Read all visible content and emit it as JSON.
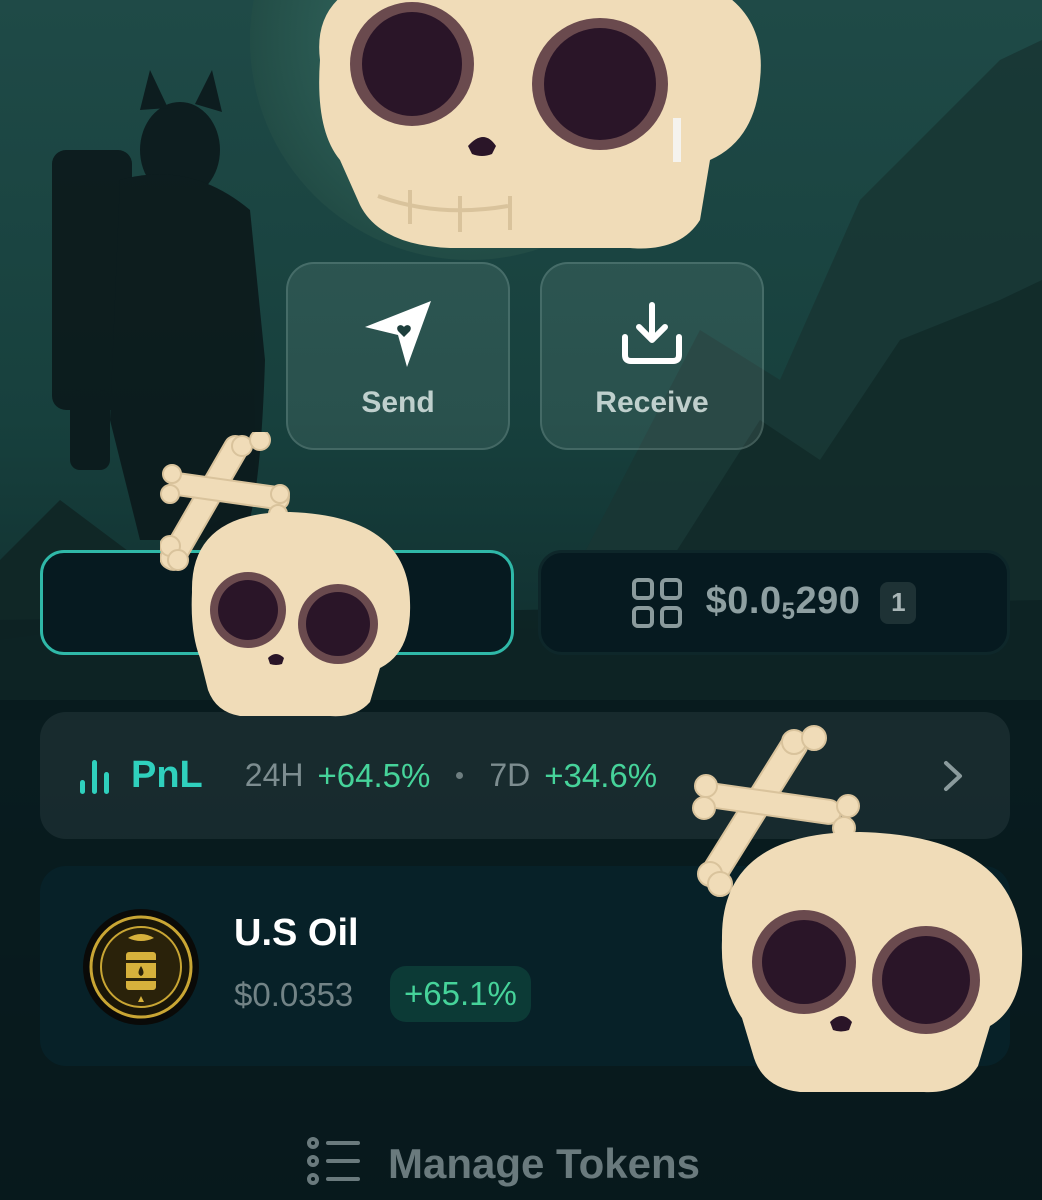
{
  "actions": {
    "send_label": "Send",
    "receive_label": "Receive"
  },
  "tabs": {
    "collectibles_value": "$0.0",
    "collectibles_value_sub": "5",
    "collectibles_value_rest": "290",
    "collectibles_count": "1"
  },
  "pnl": {
    "title": "PnL",
    "period_24h": "24H",
    "change_24h": "+64.5%",
    "period_7d": "7D",
    "change_7d": "+34.6%"
  },
  "tokens": [
    {
      "name": "U.S Oil",
      "price": "$0.0353",
      "change": "+65.1%"
    }
  ],
  "footer": {
    "manage_label": "Manage Tokens"
  },
  "colors": {
    "accent": "#2fd0bd",
    "positive": "#46d39a",
    "tab_border_active": "#2fb8a8",
    "background": "#0b1f22"
  },
  "icons": {
    "send": "send-icon",
    "receive": "receive-icon",
    "tokens_tab": "coins-icon",
    "collectibles_tab": "grid-icon",
    "pnl": "bar-chart-icon",
    "pnl_arrow": "chevron-right-icon",
    "manage": "list-icon"
  }
}
